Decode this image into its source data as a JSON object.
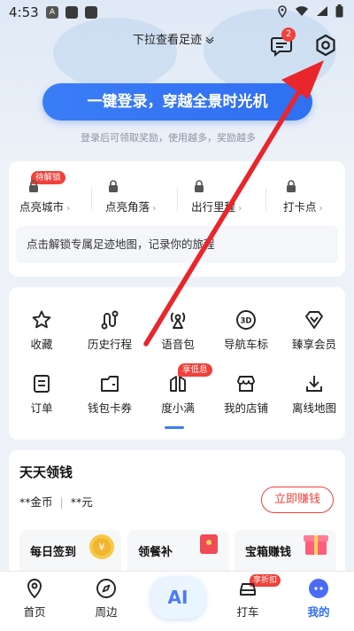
{
  "status_bar": {
    "time": "4:53",
    "notif_a": "A"
  },
  "header": {
    "pull_hint": "下拉查看足迹",
    "message_badge": "2"
  },
  "login": {
    "button": "一键登录，穿越全景时光机",
    "subtitle": "登录后可领取奖励，使用越多，奖励越多"
  },
  "unlock": {
    "pending_badge": "待解锁",
    "items": [
      {
        "label": "点亮城市"
      },
      {
        "label": "点亮角落"
      },
      {
        "label": "出行里程"
      },
      {
        "label": "打卡点"
      }
    ],
    "hint": "点击解锁专属足迹地图，记录你的旅程"
  },
  "tools": {
    "row1": [
      {
        "label": "收藏",
        "icon": "star-icon"
      },
      {
        "label": "历史行程",
        "icon": "route-icon"
      },
      {
        "label": "语音包",
        "icon": "voice-icon"
      },
      {
        "label": "导航车标",
        "icon": "car-3d-icon"
      },
      {
        "label": "臻享会员",
        "icon": "diamond-icon"
      }
    ],
    "row2": [
      {
        "label": "订单",
        "icon": "order-icon"
      },
      {
        "label": "钱包卡券",
        "icon": "wallet-icon"
      },
      {
        "label": "度小满",
        "icon": "duxiaoman-icon"
      },
      {
        "label": "我的店铺",
        "icon": "shop-icon"
      },
      {
        "label": "离线地图",
        "icon": "download-icon"
      }
    ],
    "enjoy_badge": "享低息"
  },
  "earn": {
    "title": "天天领钱",
    "coins": "**金币",
    "sep": "|",
    "yuan": "**元",
    "button": "立即赚钱",
    "tasks": [
      {
        "title": "每日签到"
      },
      {
        "title": "领餐补"
      },
      {
        "title": "宝箱赚钱"
      }
    ]
  },
  "nav": {
    "items": [
      {
        "label": "首页"
      },
      {
        "label": "周边"
      },
      {
        "label": "打车"
      },
      {
        "label": "我的"
      }
    ],
    "ai_label": "AI",
    "car_badge": "享折扣"
  },
  "colors": {
    "primary": "#2f6ff2",
    "badge_red": "#f0413a",
    "annotation_arrow": "#e8262b"
  }
}
